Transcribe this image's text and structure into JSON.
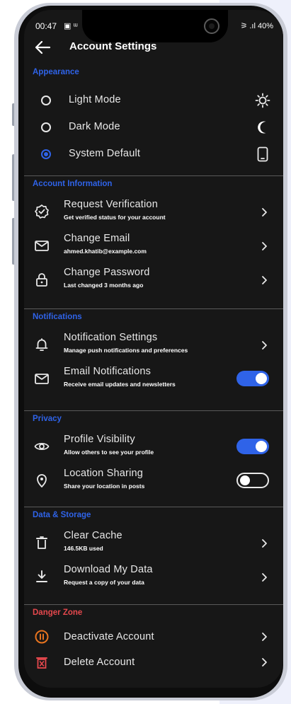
{
  "status_bar": {
    "time": "00:47",
    "left_icons": "▣ ᵚ",
    "right_text": "⚞ .ıl 40%"
  },
  "header": {
    "title": "Account Settings",
    "back_icon": "arrow-left-icon"
  },
  "sections": {
    "appearance": {
      "title": "Appearance",
      "options": [
        {
          "label": "Light Mode",
          "selected": false,
          "icon": "sun-icon"
        },
        {
          "label": "Dark Mode",
          "selected": false,
          "icon": "moon-icon"
        },
        {
          "label": "System Default",
          "selected": true,
          "icon": "phone-icon"
        }
      ]
    },
    "account_information": {
      "title": "Account Information",
      "items": [
        {
          "title": "Request Verification",
          "subtitle": "Get verified status for your account",
          "icon": "verified-badge-icon"
        },
        {
          "title": "Change Email",
          "subtitle": "ahmed.khatib@example.com",
          "icon": "mail-icon"
        },
        {
          "title": "Change Password",
          "subtitle": "Last changed 3 months ago",
          "icon": "lock-icon"
        }
      ]
    },
    "notifications": {
      "title": "Notifications",
      "items": [
        {
          "title": "Notification Settings",
          "subtitle": "Manage push notifications and preferences",
          "icon": "bell-icon"
        },
        {
          "title": "Email Notifications",
          "subtitle": "Receive email updates and newsletters",
          "icon": "mail-icon",
          "toggle": true
        }
      ]
    },
    "privacy": {
      "title": "Privacy",
      "items": [
        {
          "title": "Profile Visibility",
          "subtitle": "Allow others to see your profile",
          "icon": "eye-icon",
          "toggle": true
        },
        {
          "title": "Location Sharing",
          "subtitle": "Share your location in posts",
          "icon": "location-pin-icon",
          "toggle": false
        }
      ]
    },
    "data_storage": {
      "title": "Data & Storage",
      "items": [
        {
          "title": "Clear Cache",
          "subtitle": "146.5KB used",
          "icon": "trash-icon"
        },
        {
          "title": "Download My Data",
          "subtitle": "Request a copy of your data",
          "icon": "download-icon"
        }
      ]
    },
    "danger_zone": {
      "title": "Danger Zone",
      "items": [
        {
          "title": "Deactivate Account",
          "icon": "pause-circle-icon"
        },
        {
          "title": "Delete Account",
          "icon": "delete-box-icon"
        }
      ]
    }
  },
  "colors": {
    "accent": "#2f63e8",
    "danger": "#e5484d",
    "danger_icon": "#e8741f",
    "background": "#171717",
    "text": "#e8e8e8"
  }
}
